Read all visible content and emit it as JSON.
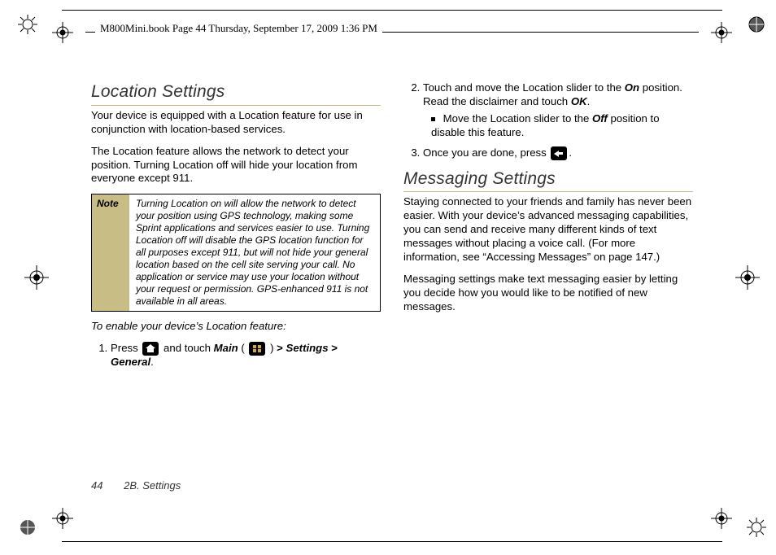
{
  "header": {
    "runner": "M800Mini.book  Page 44  Thursday, September 17, 2009  1:36 PM"
  },
  "col1": {
    "h_loc": "Location Settings",
    "p1": "Your device is equipped with a Location feature for use in conjunction with location-based services.",
    "p2": "The Location feature allows the network to detect your position. Turning Location off will hide your location from everyone except 911.",
    "note_label": "Note",
    "note_body": "Turning Location on will allow the network to detect your position using GPS technology, making some Sprint applications and services easier to use. Turning Location off will disable the GPS location function for all purposes except 911, but will not hide your general location based on the cell site serving your call. No application or service may use your location without your request or permission. GPS-enhanced 911 is not available in all areas.",
    "leadin": "To enable your device’s Location feature:",
    "step1_a": "Press ",
    "step1_b": " and touch ",
    "step1_main": "Main",
    "step1_c": " ( ",
    "step1_d": " ) ",
    "step1_e": "Settings",
    "step1_f": "General",
    "gt": ">"
  },
  "col2": {
    "step2_a": "Touch and move the Location slider to the ",
    "on": "On",
    "step2_b": " position. Read the disclaimer and touch ",
    "ok": "OK",
    "sub_a": "Move the Location slider to the ",
    "off": "Off",
    "sub_b": " position to disable this feature.",
    "step3_a": "Once you are done, press ",
    "h_msg": "Messaging Settings",
    "p_msg1": "Staying connected to your friends and family has never been easier. With your device’s advanced messaging capabilities, you can send and receive many different kinds of text messages without placing a voice call. (For more information, see “Accessing Messages” on page 147.)",
    "p_msg2": "Messaging settings make text messaging easier by letting you decide how you would like to be notified of new messages."
  },
  "footer": {
    "page": "44",
    "section": "2B. Settings"
  }
}
